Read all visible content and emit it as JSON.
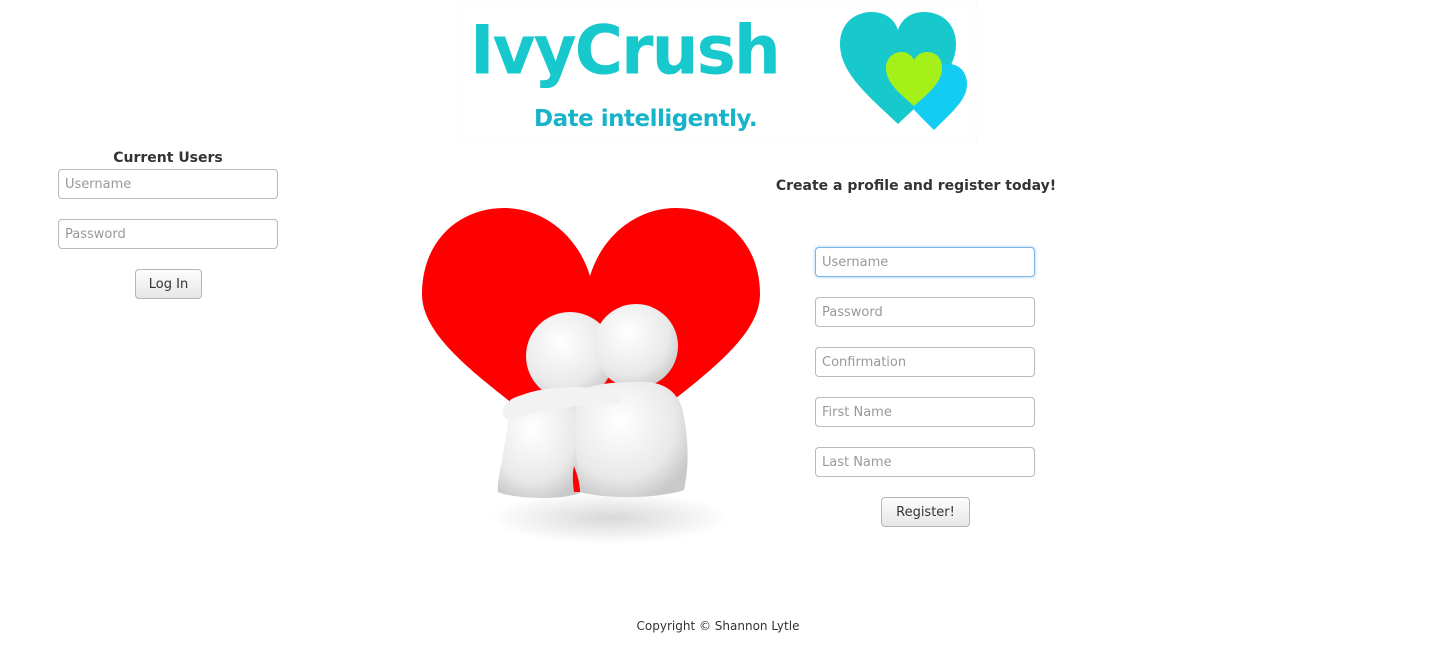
{
  "banner": {
    "brand_name": "IvyCrush",
    "tagline": "Date intelligently."
  },
  "colors": {
    "brand_teal": "#17c8cc",
    "heart_green": "#a6f01a",
    "heart_blue": "#13ccf2",
    "heart_red": "#ff0000"
  },
  "login": {
    "title": "Current Users",
    "username_placeholder": "Username",
    "password_placeholder": "Password",
    "submit_label": "Log In"
  },
  "register": {
    "title": "Create a profile and register today!",
    "username_placeholder": "Username",
    "password_placeholder": "Password",
    "confirmation_placeholder": "Confirmation",
    "first_name_placeholder": "First Name",
    "last_name_placeholder": "Last Name",
    "submit_label": "Register!"
  },
  "illustration": {
    "icon": "couple-heart-illustration"
  },
  "footer": {
    "copyright": "Copyright © Shannon Lytle"
  }
}
